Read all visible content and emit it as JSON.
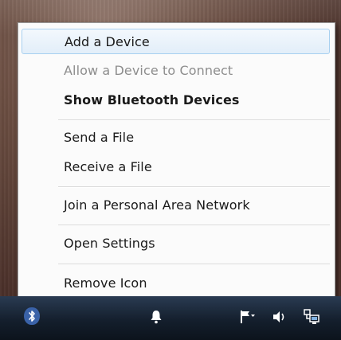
{
  "menu": {
    "items": [
      {
        "label": "Add a Device",
        "state": "highlighted"
      },
      {
        "label": "Allow a Device to Connect",
        "state": "disabled"
      },
      {
        "label": "Show Bluetooth Devices",
        "state": "default"
      },
      {
        "label": "Send a File",
        "state": "normal"
      },
      {
        "label": "Receive a File",
        "state": "normal"
      },
      {
        "label": "Join a Personal Area Network",
        "state": "normal"
      },
      {
        "label": "Open Settings",
        "state": "normal"
      },
      {
        "label": "Remove Icon",
        "state": "normal"
      }
    ]
  },
  "taskbar": {
    "tray_icons": [
      "bluetooth-icon",
      "bell-icon",
      "flag-icon",
      "speaker-icon",
      "network-icon"
    ]
  },
  "colors": {
    "highlight_border": "#a8d0f0",
    "highlight_fill": "#e2eef9",
    "disabled_text": "#8d8d8d",
    "taskbar": "#141f2d"
  }
}
